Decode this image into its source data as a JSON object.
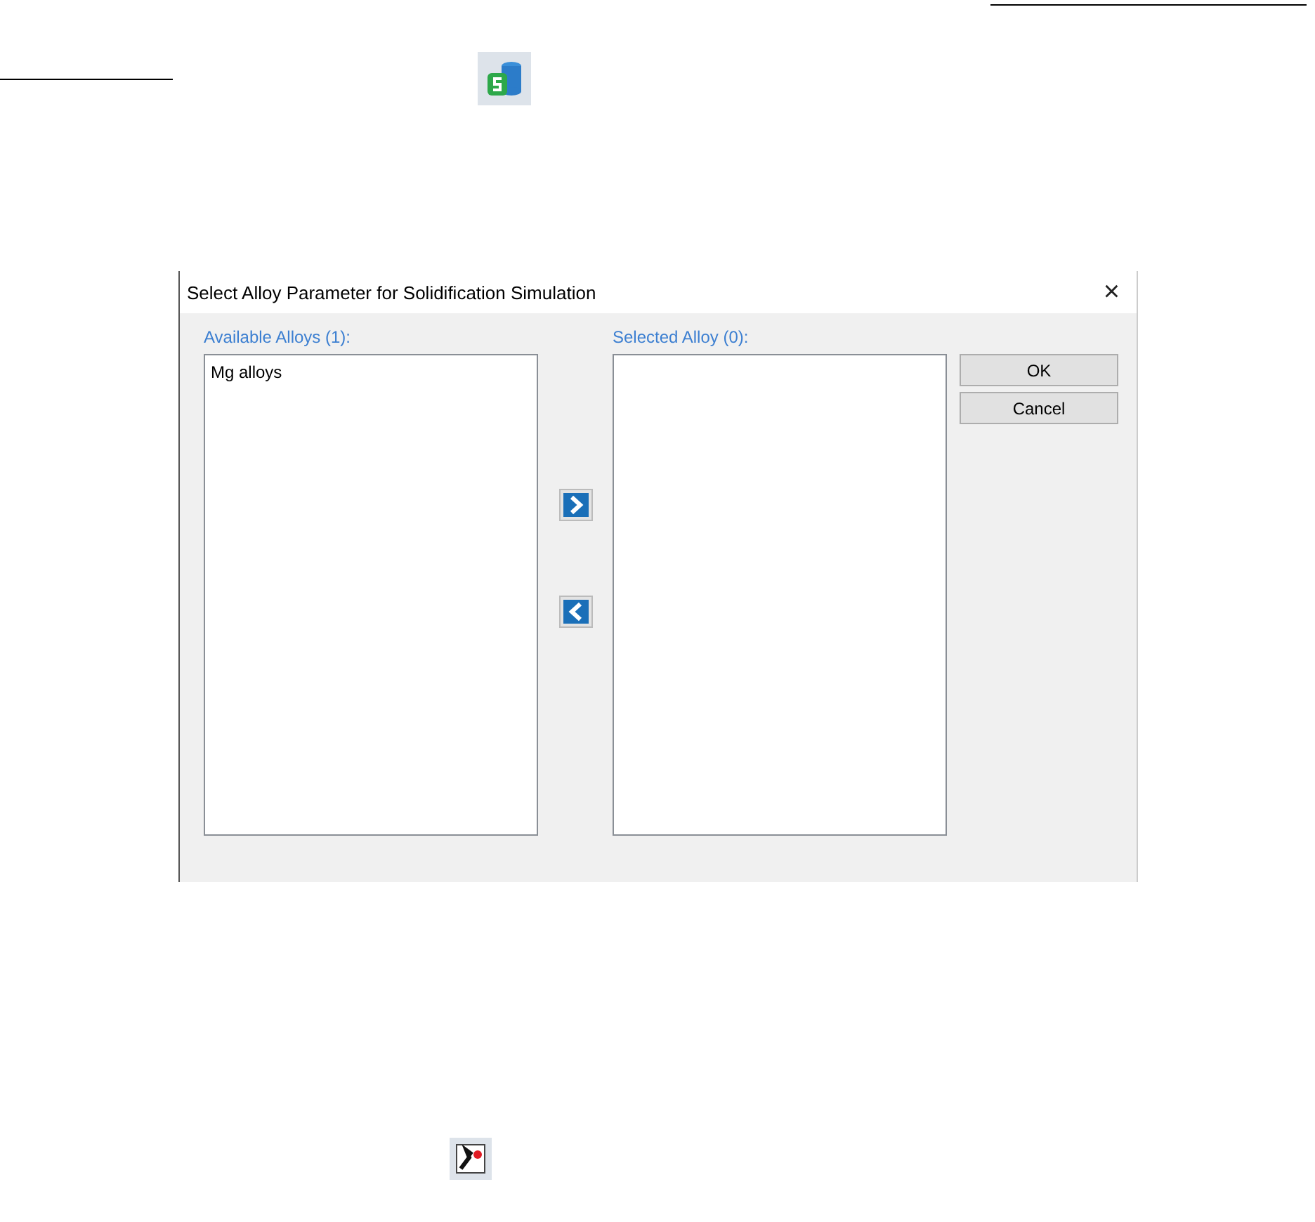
{
  "dialog": {
    "title": "Select Alloy Parameter for Solidification Simulation",
    "close": "×",
    "available": {
      "label": "Available Alloys (1):",
      "items": [
        {
          "label": "Mg alloys",
          "selected": false
        }
      ]
    },
    "selected": {
      "label": "Selected Alloy (0):"
    },
    "buttons": [
      "OK",
      "Cancel"
    ]
  }
}
